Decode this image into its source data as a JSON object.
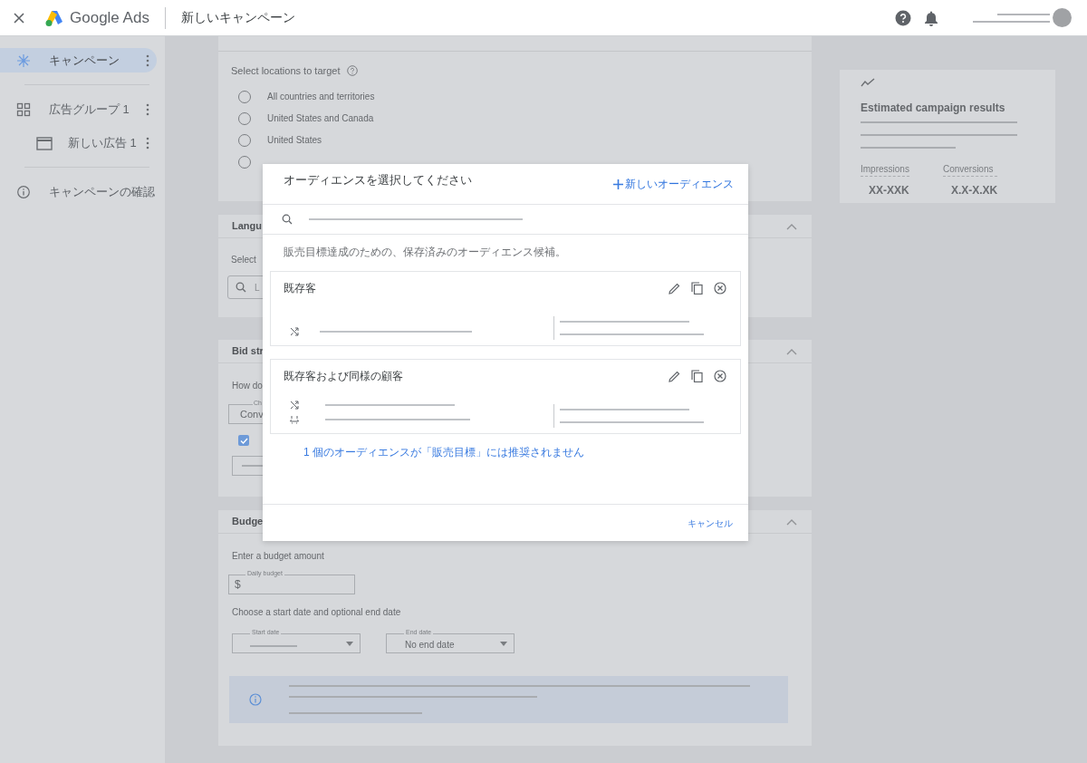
{
  "header": {
    "logo_text": "Google Ads",
    "title": "新しいキャンペーン"
  },
  "sidebar": {
    "items": [
      {
        "label": "キャンペーン",
        "kind": "campaign",
        "selected": true
      },
      {
        "label": "広告グループ 1",
        "kind": "ad_group",
        "selected": false,
        "children": [
          {
            "label": "新しい広告 1",
            "kind": "ad",
            "selected": false
          }
        ]
      },
      {
        "label": "キャンペーンの確認",
        "kind": "review",
        "selected": false
      }
    ]
  },
  "locations": {
    "title": "Select locations to target",
    "options": [
      {
        "label": "All countries and territories",
        "selected": false
      },
      {
        "label": "United States and Canada",
        "selected": false
      },
      {
        "label": "United States",
        "selected": false
      },
      {
        "selected": false
      }
    ]
  },
  "languages": {
    "title": "Langu",
    "subtitle": "Select",
    "search_value": "L"
  },
  "bid_strategy": {
    "title": "Bid str",
    "question": "How do",
    "dropdown_label": "Ch",
    "dropdown_value": "Conv",
    "checked": true
  },
  "budget": {
    "title": "Budge",
    "amount_label": "Enter a budget amount",
    "field_label": "Daily budget",
    "currency": "$",
    "dates_label": "Choose a start date and optional end date",
    "start_label": "Start date",
    "end_label": "End date",
    "end_value": "No end date"
  },
  "estimate": {
    "title": "Estimated campaign results",
    "metrics": [
      {
        "label": "Impressions",
        "value": "XX-XXK"
      },
      {
        "label": "Conversions",
        "value": "X.X-X.XK"
      }
    ]
  },
  "dialog": {
    "title": "オーディエンスを選択してください",
    "new_button": "新しいオーディエンス",
    "description": "販売目標達成のための、保存済みのオーディエンス候補。",
    "audiences": [
      {
        "name": "既存客",
        "criteria": [
          {
            "kind": "shuffle"
          }
        ]
      },
      {
        "name": "既存客および同様の顧客",
        "criteria": [
          {
            "kind": "shuffle"
          },
          {
            "kind": "split"
          }
        ]
      }
    ],
    "warning_link": "1 個のオーディエンスが「販売目標」には推奨されません",
    "cancel": "キャンセル"
  }
}
